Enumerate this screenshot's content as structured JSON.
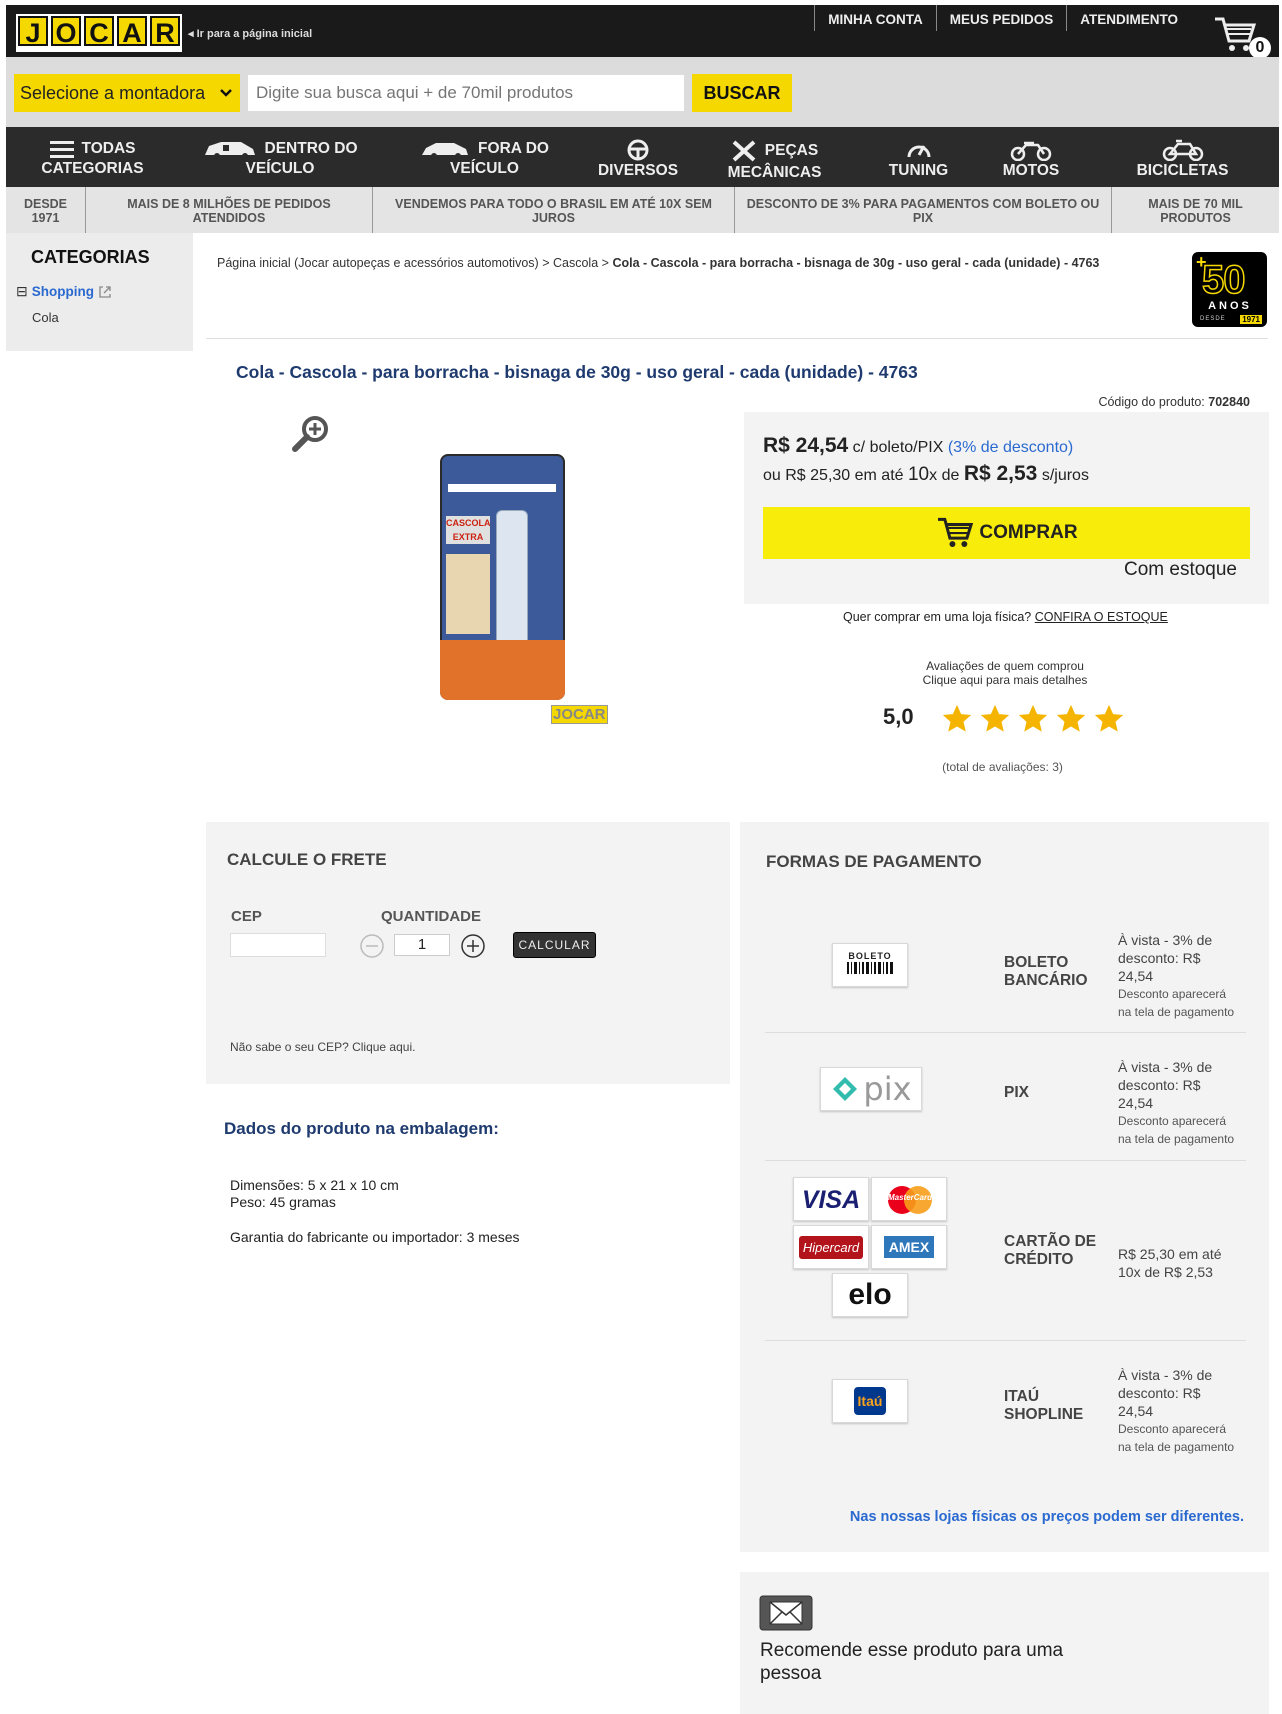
{
  "header": {
    "logo_letters": [
      "J",
      "O",
      "C",
      "A",
      "R"
    ],
    "home_link": "Ir para a página inicial",
    "top_links": [
      "MINHA CONTA",
      "MEUS PEDIDOS",
      "ATENDIMENTO"
    ],
    "cart_count": "0"
  },
  "search": {
    "brand_select": "Selecione a montadora",
    "placeholder": "Digite sua busca aqui + de 70mil produtos",
    "button": "BUSCAR"
  },
  "nav": [
    {
      "l1": "TODAS",
      "l2": "CATEGORIAS",
      "icon": "menu-icon"
    },
    {
      "l1": "DENTRO DO",
      "l2": "VEÍCULO",
      "icon": "car-interior-icon"
    },
    {
      "l1": "FORA DO",
      "l2": "VEÍCULO",
      "icon": "car-icon"
    },
    {
      "l1": "",
      "l2": "DIVERSOS",
      "icon": "steering-wheel-icon"
    },
    {
      "l1": "PEÇAS",
      "l2": "MECÂNICAS",
      "icon": "tools-icon"
    },
    {
      "l1": "",
      "l2": "TUNING",
      "icon": "speedometer-icon"
    },
    {
      "l1": "",
      "l2": "MOTOS",
      "icon": "motorcycle-icon"
    },
    {
      "l1": "",
      "l2": "BICICLETAS",
      "icon": "bicycle-icon"
    }
  ],
  "strip": [
    {
      "l1": "DESDE",
      "l2": "1971"
    },
    {
      "l1": "MAIS DE 8 MILHÕES DE PEDIDOS",
      "l2": "ATENDIDOS"
    },
    {
      "l1": "VENDEMOS PARA TODO O BRASIL EM ATÉ 10X SEM",
      "l2": "JUROS"
    },
    {
      "l1": "DESCONTO DE 3% PARA PAGAMENTOS COM BOLETO OU",
      "l2": "PIX"
    },
    {
      "l1": "MAIS DE 70 MIL",
      "l2": "PRODUTOS"
    }
  ],
  "sidebar": {
    "title": "CATEGORIAS",
    "toggle": "⊟",
    "shopping": "Shopping",
    "sub": "Cola"
  },
  "breadcrumb": {
    "home": "Página inicial (Jocar autopeças e acessórios automotivos)",
    "sep": ">",
    "cat": "Cascola",
    "current": "Cola - Cascola - para borracha - bisnaga de 30g - uso geral - cada (unidade) - 4763"
  },
  "badge": {
    "plus": "+",
    "num": "50",
    "anos": "ANOS",
    "desde": "DESDE",
    "year": "1971"
  },
  "product": {
    "title": "Cola - Cascola - para borracha - bisnaga de 30g - uso geral - cada (unidade) - 4763",
    "code_label": "Código do produto:",
    "code": "702840",
    "package_brand": "CASCOLA",
    "package_sub": "EXTRA",
    "watermark": "JOCAR"
  },
  "price": {
    "main": "R$ 24,54",
    "main_suffix": " c/ boleto/PIX ",
    "discount": "(3% de desconto)",
    "inst_pre": "ou R$ 25,30 em até ",
    "inst_n": "10",
    "inst_x": "x de ",
    "inst_val": "R$ 2,53",
    "inst_suf": " s/juros",
    "buy": "COMPRAR",
    "stock": "Com estoque"
  },
  "store": {
    "q": "Quer comprar em uma loja física? ",
    "link": "CONFIRA O ESTOQUE"
  },
  "reviews": {
    "l1": "Avaliações de quem comprou",
    "l2": "Clique aqui para mais detalhes",
    "score": "5,0",
    "rating": 5,
    "total": "(total de avaliações: 3)"
  },
  "frete": {
    "title": "CALCULE O FRETE",
    "cep": "CEP",
    "qty_label": "QUANTIDADE",
    "qty": "1",
    "calc": "CALCULAR",
    "help": "Não sabe o seu CEP? Clique aqui."
  },
  "dados": {
    "title": "Dados do produto na embalagem:",
    "dim": "Dimensões: 5 x 21 x 10 cm",
    "peso": "Peso: 45 gramas",
    "garantia": "Garantia do fabricante ou importador: 3 meses"
  },
  "payment": {
    "title": "FORMAS DE PAGAMENTO",
    "boleto_logo": "BOLETO",
    "pix_logo": "pix",
    "cards": {
      "visa": "VISA",
      "master": "MasterCard",
      "hiper": "Hipercard",
      "amex": "AMEX",
      "elo": "elo"
    },
    "itau_logo": "Itaú",
    "rows": [
      {
        "name1": "BOLETO",
        "name2": "BANCÁRIO",
        "d1": "À vista - 3% de",
        "d2": "desconto: R$",
        "d3": "24,54",
        "n1": "Desconto aparecerá",
        "n2": "na tela de pagamento"
      },
      {
        "name1": "PIX",
        "name2": "",
        "d1": "À vista - 3% de",
        "d2": "desconto: R$",
        "d3": "24,54",
        "n1": "Desconto aparecerá",
        "n2": "na tela de pagamento"
      },
      {
        "name1": "CARTÃO DE",
        "name2": "CRÉDITO",
        "d1": "R$ 25,30 em até",
        "d2": "10x de R$ 2,53",
        "d3": "",
        "n1": "",
        "n2": ""
      },
      {
        "name1": "ITAÚ",
        "name2": "SHOPLINE",
        "d1": "À vista - 3% de",
        "d2": "desconto: R$",
        "d3": "24,54",
        "n1": "Desconto aparecerá",
        "n2": "na tela de pagamento"
      }
    ],
    "note": "Nas nossas lojas físicas os preços podem ser diferentes."
  },
  "recommend": {
    "l1": "Recomende esse produto para uma",
    "l2": "pessoa"
  },
  "colors": {
    "brand_yellow": "#f5d800",
    "dark": "#1a1a1a",
    "link_blue": "#2a6ad0",
    "title_blue": "#1e3a6e",
    "star": "#f5b400"
  }
}
